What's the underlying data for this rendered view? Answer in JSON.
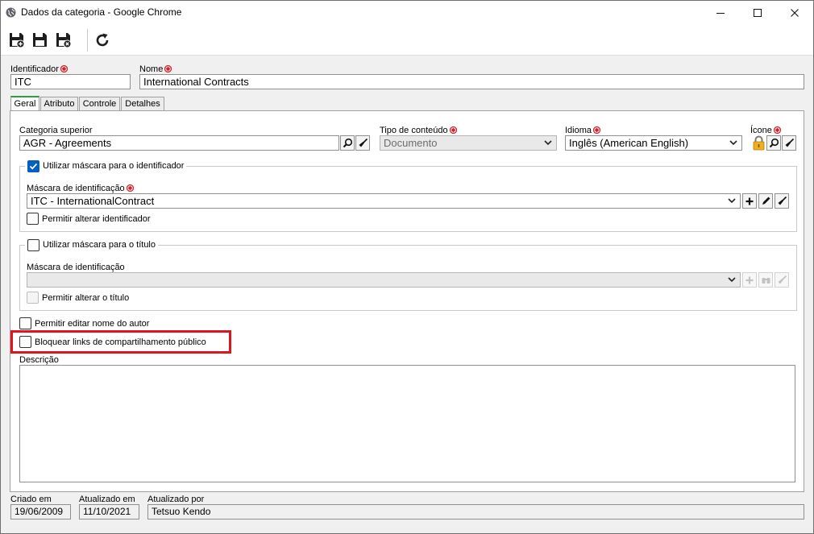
{
  "window": {
    "title": "Dados da categoria - Google Chrome"
  },
  "toolbar": {
    "buttons": [
      "save-new-icon",
      "save-icon",
      "save-close-icon",
      "refresh-icon"
    ]
  },
  "header": {
    "identifier_label": "Identificador",
    "identifier_value": "ITC",
    "name_label": "Nome",
    "name_value": "International Contracts"
  },
  "tabs": [
    {
      "label": "Geral",
      "active": true
    },
    {
      "label": "Atributo",
      "active": false
    },
    {
      "label": "Controle",
      "active": false
    },
    {
      "label": "Detalhes",
      "active": false
    }
  ],
  "general": {
    "parent_label": "Categoria superior",
    "parent_value": "AGR - Agreements",
    "content_type_label": "Tipo de conteúdo",
    "content_type_value": "Documento",
    "language_label": "Idioma",
    "language_value": "Inglês (American English)",
    "icon_label": "Ícone",
    "id_mask_group": {
      "checkbox_label": "Utilizar máscara para o identificador",
      "checked": true,
      "mask_label": "Máscara de identificação",
      "mask_value": "ITC - InternationalContract",
      "allow_label": "Permitir alterar identificador",
      "allow_checked": false
    },
    "title_mask_group": {
      "checkbox_label": "Utilizar máscara para o título",
      "checked": false,
      "mask_label": "Máscara de identificação",
      "mask_value": "",
      "allow_label": "Permitir alterar o título",
      "allow_checked": false
    },
    "allow_author_label": "Permitir editar nome do autor",
    "block_links_label": "Bloquear links de compartilhamento público",
    "description_label": "Descrição",
    "description_value": ""
  },
  "footer": {
    "created_label": "Criado em",
    "created_value": "19/06/2009",
    "updated_label": "Atualizado em",
    "updated_value": "11/10/2021",
    "updated_by_label": "Atualizado por",
    "updated_by_value": "Tetsuo Kendo"
  },
  "colors": {
    "required": "#d0202a",
    "highlight": "#e0141c",
    "check": "#0060c0",
    "tab_accent": "#2e9e3e"
  }
}
